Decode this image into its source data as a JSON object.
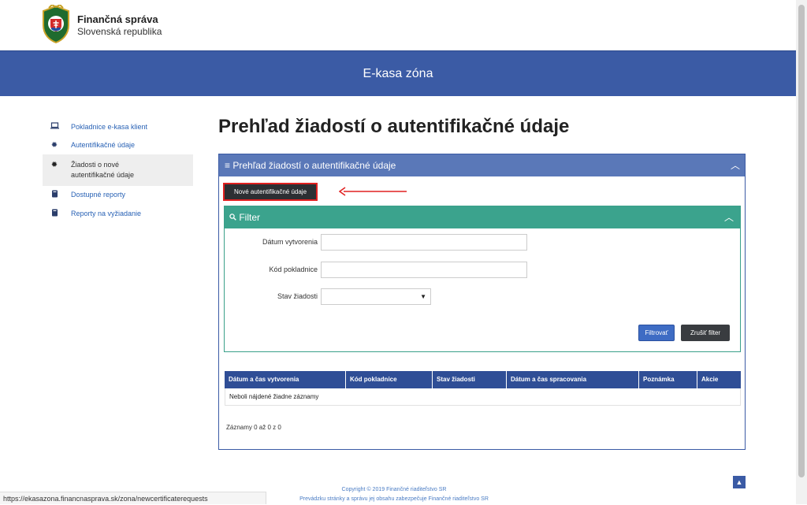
{
  "header": {
    "brand_name": "Finančná správa",
    "brand_sub": "Slovenská republika",
    "banner_title": "E-kasa zóna"
  },
  "sidebar": {
    "items": [
      {
        "label": "Pokladnice e-kasa klient",
        "icon": "laptop-icon"
      },
      {
        "label": "Autentifikačné údaje",
        "icon": "certificate-icon"
      },
      {
        "label": "Žiadosti o nové autentifikačné údaje",
        "icon": "certificate-icon"
      },
      {
        "label": "Dostupné reporty",
        "icon": "book-icon"
      },
      {
        "label": "Reporty na vyžiadanie",
        "icon": "book-icon"
      }
    ]
  },
  "main": {
    "page_title": "Prehľad žiadostí o autentifikačné údaje",
    "panel_title": "Prehľad žiadostí o autentifikačné údaje",
    "new_button": "Nové autentifikačné údaje",
    "filter": {
      "title": "Filter",
      "fields": [
        {
          "label": "Dátum vytvorenia",
          "value": ""
        },
        {
          "label": "Kód pokladnice",
          "value": ""
        },
        {
          "label": "Stav žiadosti",
          "value": ""
        }
      ],
      "apply_button": "Filtrovať",
      "clear_button": "Zrušiť filter"
    },
    "table": {
      "columns": [
        "Dátum a čas vytvorenia",
        "Kód pokladnice",
        "Stav žiadosti",
        "Dátum a čas spracovania",
        "Poznámka",
        "Akcie"
      ],
      "empty_message": "Neboli nájdené žiadne záznamy"
    },
    "records_info": "Záznamy 0 až 0 z 0"
  },
  "footer": {
    "copyright": "Copyright © 2019 Finančné riaditeľstvo SR",
    "operator": "Prevádzku stránky a správu jej obsahu zabezpečuje Finančné riaditeľstvo SR"
  },
  "browser": {
    "status_url": "https://ekasazona.financnasprava.sk/zona/newcertificaterequests"
  },
  "colors": {
    "banner": "#3b5ba5",
    "filter": "#3ba38d",
    "table_header": "#2f4e96",
    "highlight": "#e02020"
  }
}
